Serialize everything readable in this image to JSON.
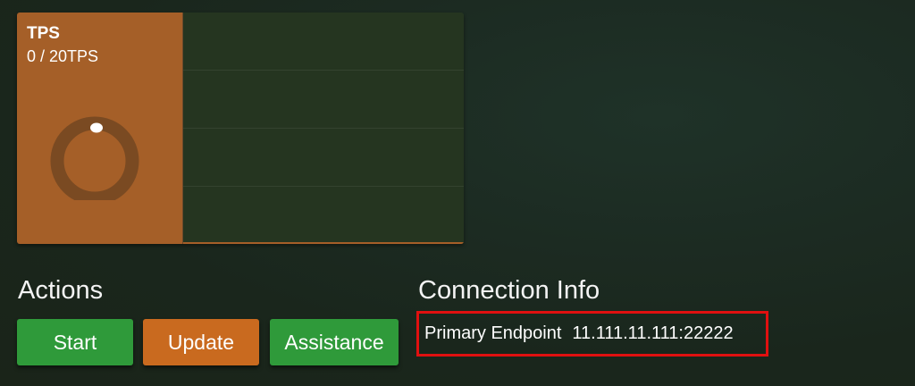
{
  "tps": {
    "title": "TPS",
    "value": "0 / 20TPS",
    "gauge_level": 0,
    "colors": {
      "panel": "#a55f28",
      "ring": "#7a4a22",
      "indicator": "#ffffff",
      "chart_bg": "#253520"
    }
  },
  "actions": {
    "title": "Actions",
    "buttons": [
      {
        "label": "Start",
        "color": "#2f9a3a"
      },
      {
        "label": "Update",
        "color": "#c96a1f"
      },
      {
        "label": "Assistance",
        "color": "#2f9a3a"
      }
    ]
  },
  "connection": {
    "title": "Connection Info",
    "primary_label": "Primary Endpoint",
    "primary_value": "11.111.11.111:22222",
    "highlight_color": "#e01010"
  }
}
